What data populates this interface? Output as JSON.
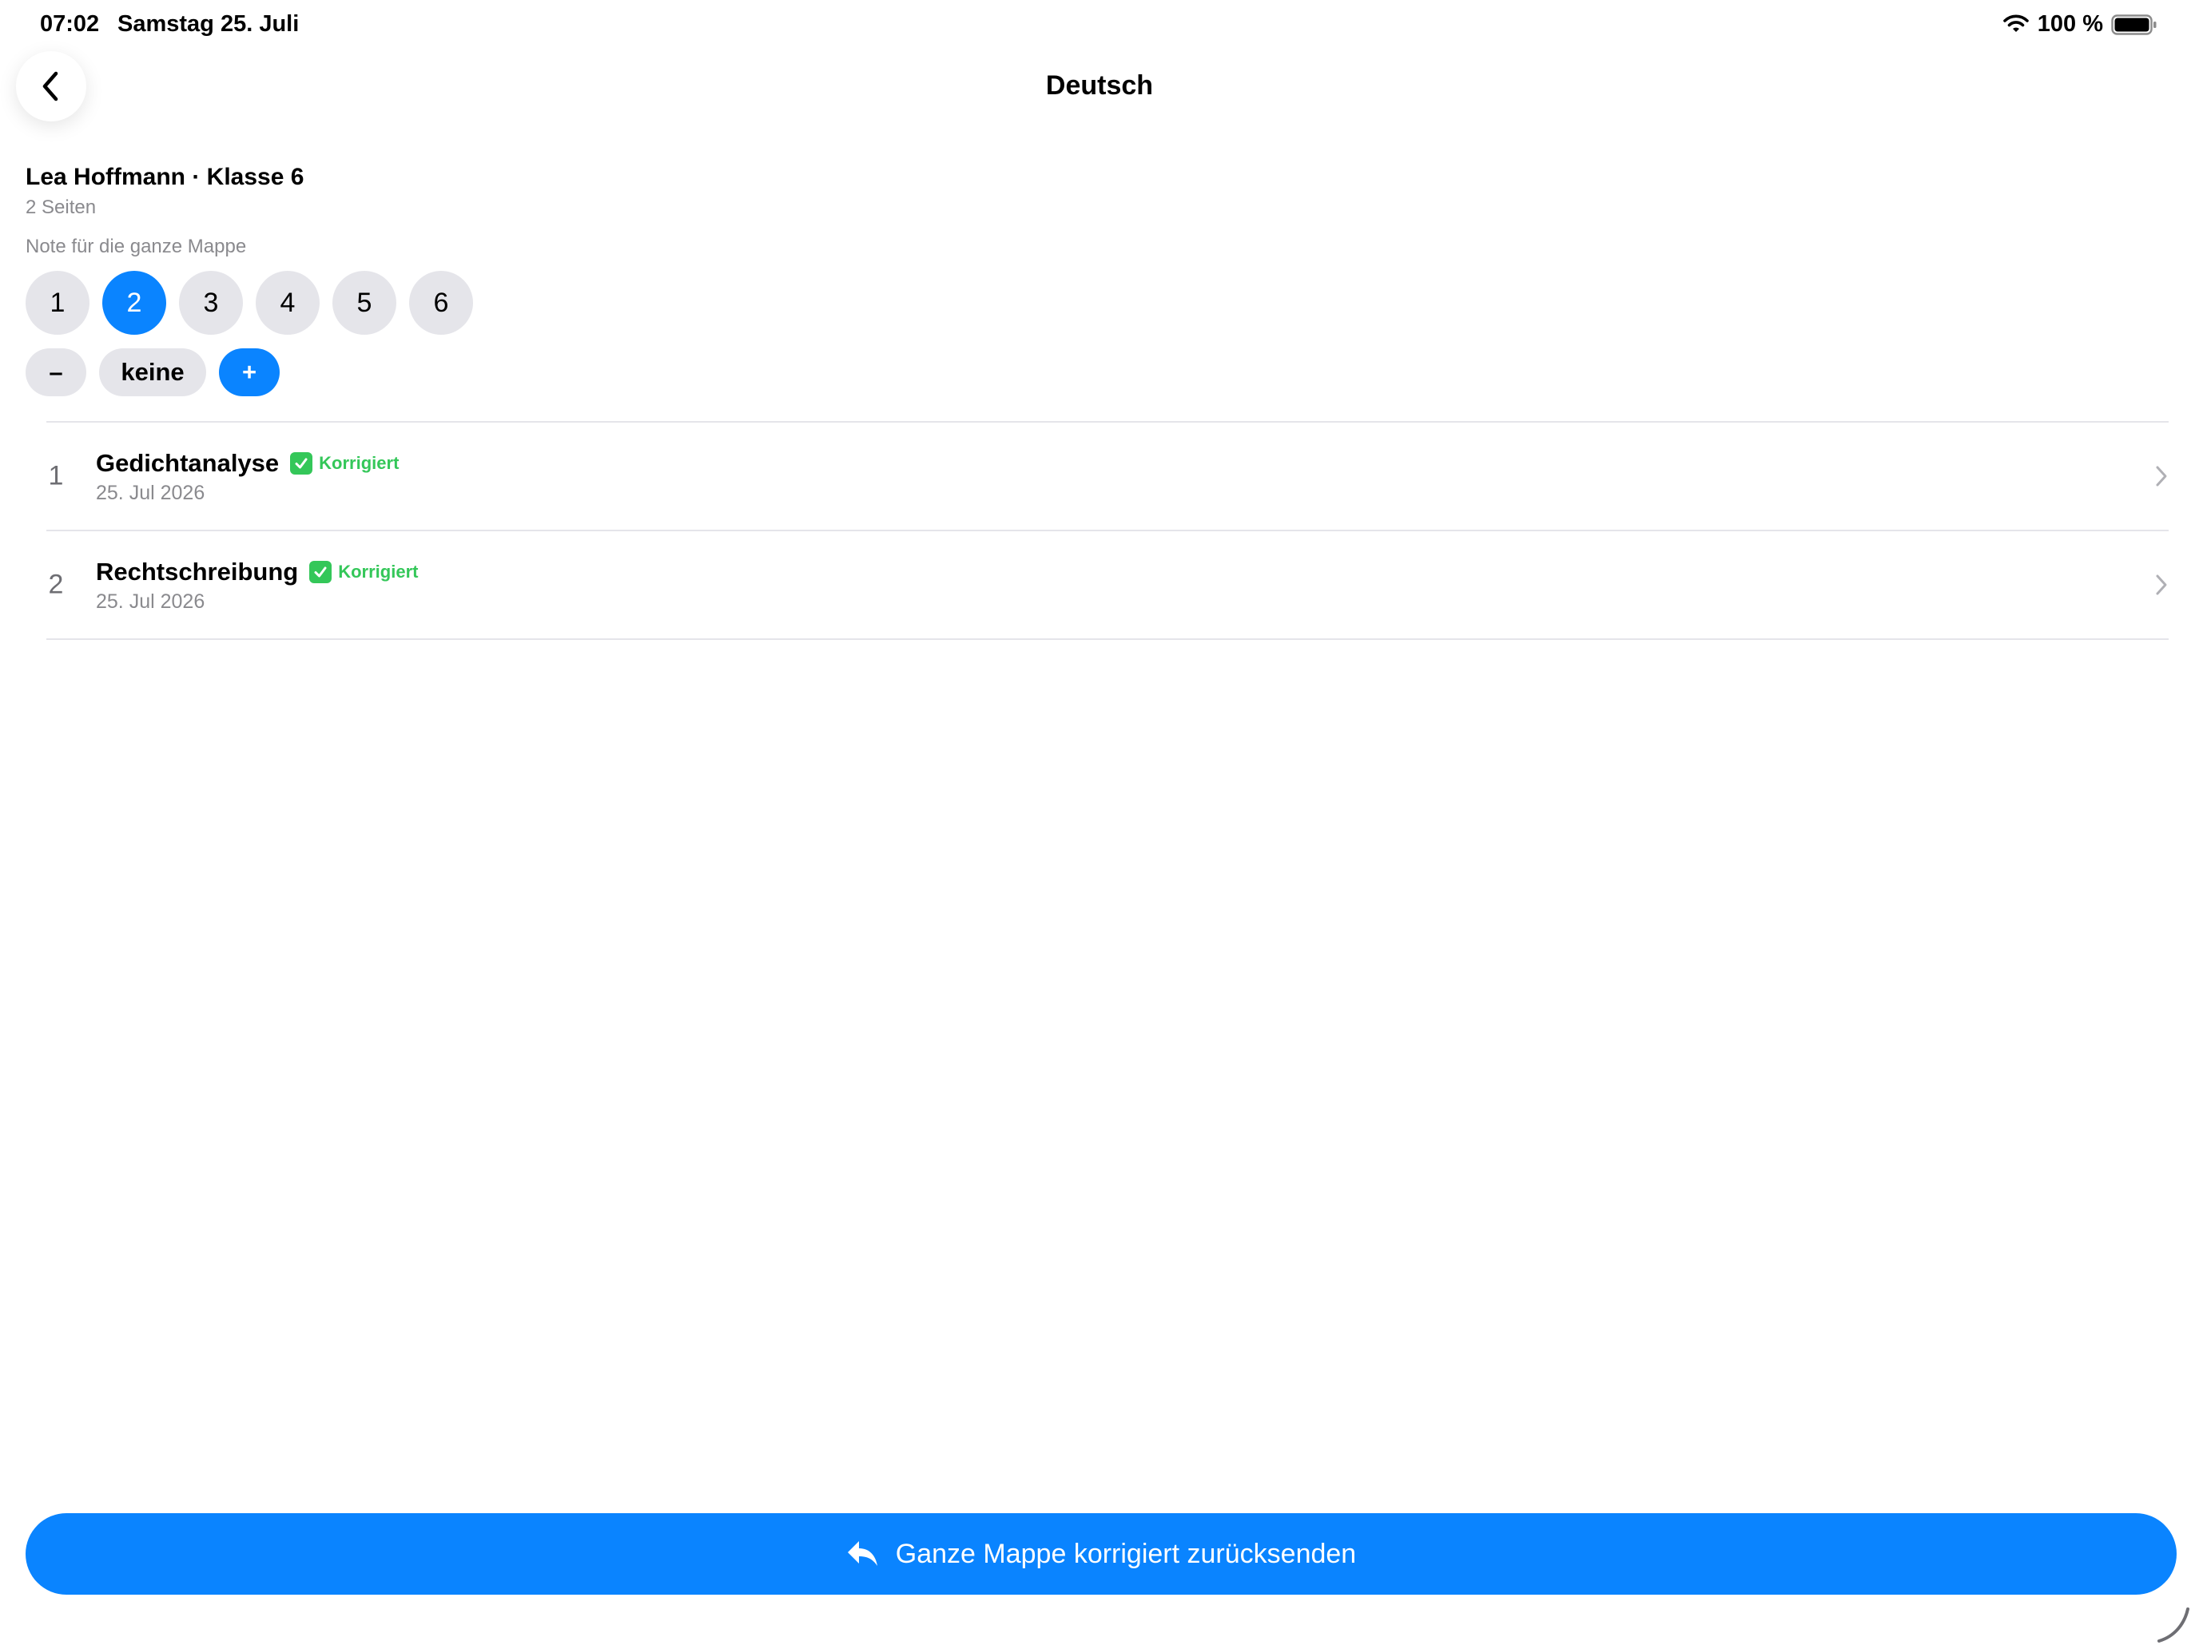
{
  "status_bar": {
    "time": "07:02",
    "date": "Samstag 25. Juli",
    "battery_text": "100 %"
  },
  "nav": {
    "title": "Deutsch",
    "back_icon": "chevron-left-icon"
  },
  "header": {
    "student": "Lea Hoffmann · Klasse 6",
    "pages": "2 Seiten",
    "grade_label": "Note für die ganze Mappe"
  },
  "grades": {
    "options": [
      "1",
      "2",
      "3",
      "4",
      "5",
      "6"
    ],
    "selected": "2",
    "modifiers": {
      "minus": "–",
      "none": "keine",
      "plus": "+"
    },
    "active_modifier": "plus"
  },
  "pages_list": [
    {
      "number": "1",
      "title": "Gedichtanalyse",
      "status": "Korrigiert",
      "date": "25. Jul 2026"
    },
    {
      "number": "2",
      "title": "Rechtschreibung",
      "status": "Korrigiert",
      "date": "25. Jul 2026"
    }
  ],
  "send_button": {
    "label": "Ganze Mappe korrigiert zurücksenden",
    "icon": "reply-arrow-icon"
  },
  "colors": {
    "accent": "#0a84ff",
    "success": "#34c759",
    "chip": "#e5e5ea",
    "secondary_text": "#8a8a8e"
  }
}
